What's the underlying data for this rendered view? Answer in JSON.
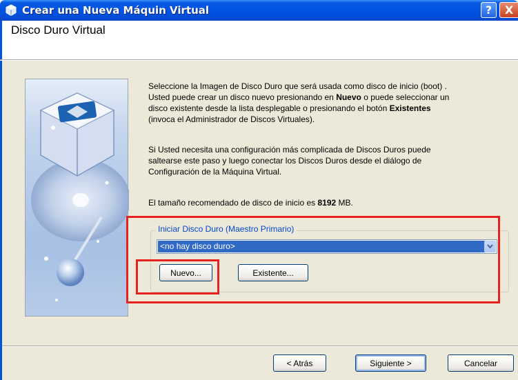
{
  "window": {
    "title": "Crear una Nueva Máquin Virtual",
    "help_label": "?",
    "close_label": "X"
  },
  "header": {
    "title": "Disco Duro Virtual"
  },
  "description": {
    "p1_a": "Seleccione la Imagen de Disco Duro que será usada como disco de inicio (boot) .",
    "p1_b": "Usted puede crear un disco nuevo presionando en ",
    "p1_b_bold": "Nuevo",
    "p1_b2": " o puede seleccionar un",
    "p1_c": "disco existente desde la lista desplegable o presionando el botón ",
    "p1_c_bold": "Existentes",
    "p1_d": "(invoca el Administrador de Discos Virtuales).",
    "p2_a": "Si Usted necesita una configuración más complicada de Discos Duros puede",
    "p2_b": "saltearse este paso y luego conectar los Discos Duros desde el diálogo de",
    "p2_c": "Configuración de la Máquina Virtual.",
    "p3_a": "El tamaño recomendado de disco de inicio es ",
    "p3_bold": "8192",
    "p3_b": " MB."
  },
  "disk_group": {
    "legend": "Iniciar Disco Duro (Maestro Primario)",
    "selected_value": "<no hay disco duro>",
    "new_button": "Nuevo...",
    "existing_button": "Existente..."
  },
  "footer": {
    "back_button": "< Atrás",
    "next_button": "Siguiente >",
    "cancel_button": "Cancelar"
  },
  "colors": {
    "titlebar": "#0054e3",
    "selection": "#316ac5",
    "highlight": "#e8201f",
    "legend": "#0046d5"
  }
}
